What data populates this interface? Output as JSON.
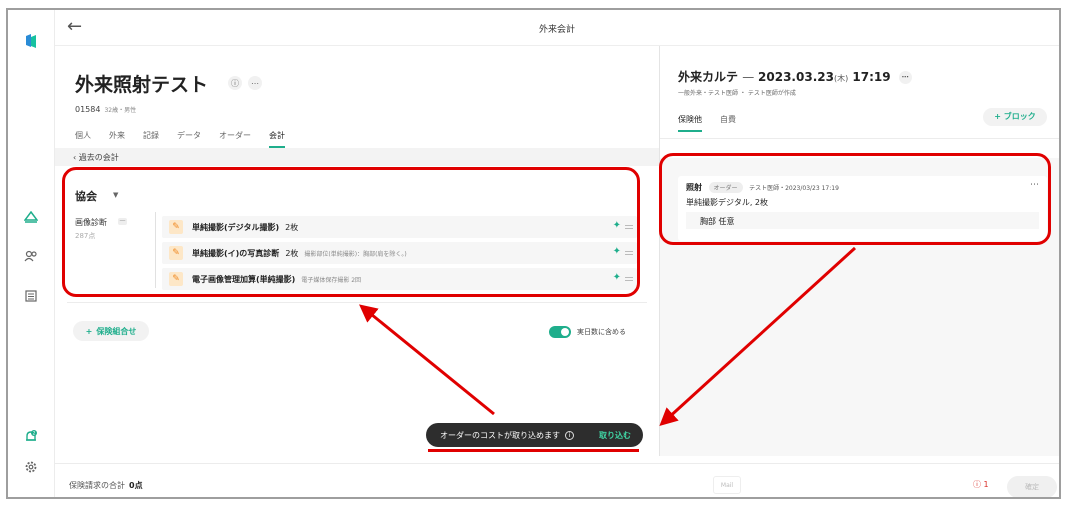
{
  "header": {
    "title": "外来会計",
    "back_icon": "arrow-left-icon"
  },
  "sidebar": {
    "icons": [
      "logo-icon",
      "triangle-icon",
      "users-icon",
      "list-icon",
      "bell-icon",
      "settings-icon"
    ],
    "bell_badge": "2"
  },
  "patient": {
    "name": "外来照射テスト",
    "id": "01584",
    "age_sex": "32歳・男性",
    "tabs": [
      "個人",
      "外来",
      "記録",
      "データ",
      "オーダー",
      "会計"
    ],
    "active_tab": "会計"
  },
  "subbar": {
    "label": "過去の会計"
  },
  "billing": {
    "group_title": "協会",
    "category": "画像診断",
    "category_badge": "一",
    "category_points": "287点",
    "rows": [
      {
        "name": "単純撮影(デジタル撮影)",
        "qty": "2枚",
        "note": ""
      },
      {
        "name": "単純撮影(イ)の写真診断",
        "qty": "2枚",
        "note": "撮影部位(単純撮影)：胸部(肩を除く。)"
      },
      {
        "name": "電子画像管理加算(単純撮影)",
        "qty": "",
        "note": "電子媒体保存撮影 2回"
      }
    ]
  },
  "actions": {
    "add_insurance": "保険組合せ",
    "toggle_label": "実日数に含める",
    "toggle_on": true
  },
  "karte": {
    "title": "外来カルテ",
    "date": "2023.03.23",
    "weekday": "(木)",
    "time": "17:19",
    "meta": "一般外来・テスト医師 ・ テスト医師が作成",
    "tabs": [
      "保険他",
      "自費"
    ],
    "active_tab": "保険他",
    "block_button": "+ ブロック"
  },
  "order_card": {
    "title": "照射",
    "tag": "オーダー",
    "author": "テスト医師・2023/03/23 17:19",
    "item": "単純撮影デジタル, 2枚",
    "sub_item": "胸部 任意"
  },
  "toast": {
    "message": "オーダーのコストが取り込めます",
    "action": "取り込む"
  },
  "footer": {
    "sum_label": "保険請求の合計",
    "sum_value": "0点",
    "mail": "Mail",
    "warning_count": "1",
    "confirm": "確定"
  },
  "colors": {
    "accent": "#1fae8c",
    "highlight": "#e00000",
    "toast_bg": "#2d2d2d"
  }
}
